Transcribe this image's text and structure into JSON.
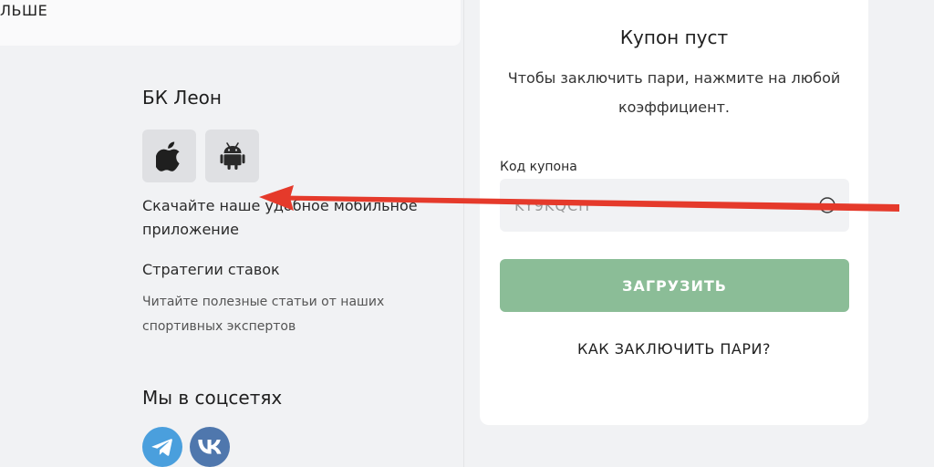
{
  "top_card": {
    "text": "ЛЬШЕ"
  },
  "footer": {
    "brand_title": "БК Леон",
    "apps": {
      "apple_icon": "apple-icon",
      "android_icon": "android-icon"
    },
    "download_text": "Скачайте наше удобное мобильное приложение",
    "strategies_title": "Стратегии ставок",
    "strategies_desc": "Читайте полезные статьи от наших спортивных экспертов",
    "social_title": "Мы в соцсетях",
    "social": [
      {
        "icon": "telegram-icon",
        "color": "#4a9fdd"
      },
      {
        "icon": "vk-icon",
        "color": "#4f77ad"
      }
    ]
  },
  "coupon": {
    "title": "Купон пуст",
    "desc": "Чтобы заключить пари, нажмите на любой коэффициент.",
    "code_label": "Код купона",
    "code_value": "KY9KQCH",
    "load_label": "ЗАГРУЗИТЬ",
    "how_label": "КАК ЗАКЛЮЧИТЬ ПАРИ?",
    "accent": "#8bbd97"
  },
  "annotation": {
    "arrow_color": "#e53a2b"
  }
}
